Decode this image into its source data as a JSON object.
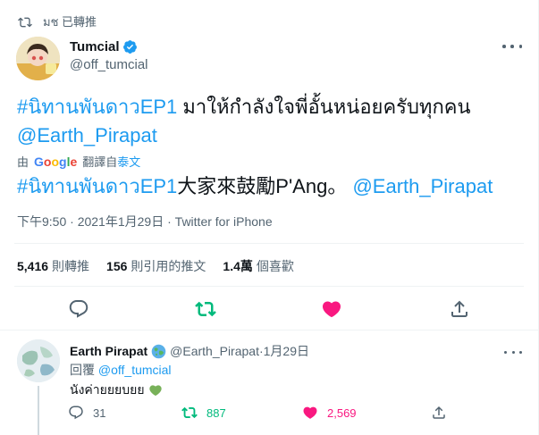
{
  "retweet": {
    "label": "มช 已轉推",
    "icon": "retweet-icon"
  },
  "author": {
    "name": "Tumcial",
    "handle": "@off_tumcial",
    "verified_icon": "verified-badge-icon"
  },
  "tweet": {
    "hashtag": "#นิทานพันดาวEP1",
    "text": " มาให้กำลังใจพี่อั้นหน่อยครับทุกคน",
    "mention": "@Earth_Pirapat"
  },
  "translate": {
    "prefix": "由",
    "google": [
      "G",
      "o",
      "o",
      "g",
      "l",
      "e"
    ],
    "suffix": "翻譯自",
    "language": "泰文"
  },
  "translation": {
    "hashtag": "#นิทานพันดาวEP1",
    "text": "大家來鼓勵P'Ang。",
    "mention": "@Earth_Pirapat"
  },
  "meta": {
    "time": "下午9:50",
    "sep": " · ",
    "date": "2021年1月29日",
    "source": "Twitter for iPhone"
  },
  "stats": {
    "retweets": {
      "count": "5,416",
      "label": "則轉推"
    },
    "quotes": {
      "count": "156",
      "label": "則引用的推文"
    },
    "likes": {
      "count": "1.4萬",
      "label": "個喜歡"
    }
  },
  "actions": [
    "reply-icon",
    "retweet-icon",
    "like-icon",
    "share-icon"
  ],
  "colors": {
    "link": "#1d9bf0",
    "retweet_green": "#00ba7c",
    "like_red": "#f91880",
    "muted": "#536471"
  },
  "reply": {
    "name": "Earth Pirapat",
    "handle": "@Earth_Pirapat",
    "sep": " · ",
    "date": "1月29日",
    "reply_prefix": "回覆",
    "reply_to": "@off_tumcial",
    "text": "นังค่ายยยบยย",
    "emoji_icon": "green-heart-icon",
    "counts": {
      "replies": "31",
      "retweets": "887",
      "likes": "2,569"
    }
  }
}
